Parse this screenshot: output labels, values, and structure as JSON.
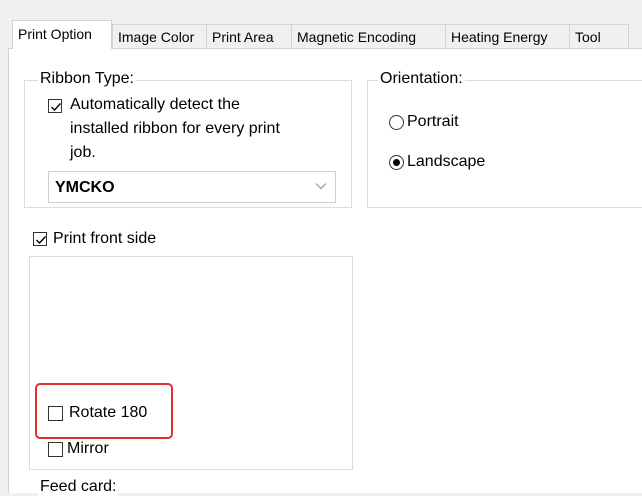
{
  "tabs": [
    {
      "label": "Print Option",
      "active": true
    },
    {
      "label": "Image Color",
      "active": false
    },
    {
      "label": "Print Area",
      "active": false
    },
    {
      "label": "Magnetic Encoding",
      "active": false
    },
    {
      "label": "Heating Energy",
      "active": false
    },
    {
      "label": "Tool",
      "active": false
    }
  ],
  "ribbon": {
    "legend": "Ribbon Type:",
    "auto_detect_line1": "Automatically detect the",
    "auto_detect_line2": "installed ribbon for every print",
    "auto_detect_line3": "job.",
    "auto_detect_checked": true,
    "selected": "YMCKO",
    "chevron_icon": "chevron-down-icon"
  },
  "orientation": {
    "legend": "Orientation:",
    "options": [
      {
        "label": "Portrait",
        "selected": false
      },
      {
        "label": "Landscape",
        "selected": true
      }
    ]
  },
  "front_side": {
    "label": "Print front side",
    "checked": true,
    "rotate_label": "Rotate 180",
    "rotate_checked": false,
    "mirror_label": "Mirror",
    "mirror_checked": false
  },
  "feed_card": {
    "legend": "Feed card:"
  },
  "colors": {
    "highlight": "#e03030",
    "panel_bg": "#ffffff",
    "window_bg": "#f0f0f0"
  }
}
